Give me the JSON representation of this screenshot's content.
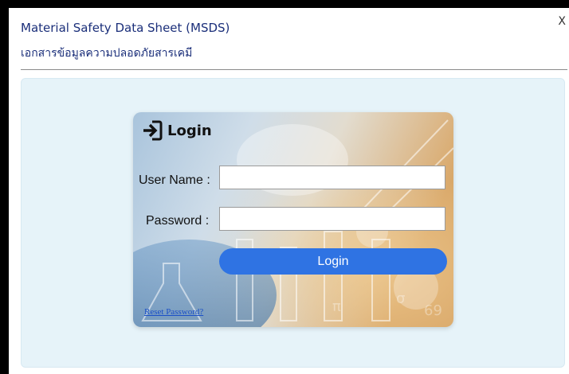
{
  "header": {
    "title": "Material Safety Data Sheet (MSDS)",
    "subtitle": "เอกสารข้อมูลความปลอดภัยสารเคมี",
    "close_label": "X"
  },
  "login": {
    "title": "Login",
    "username_label": "User Name :",
    "username_value": "",
    "password_label": "Password :",
    "password_value": "",
    "submit_label": "Login",
    "reset_link": "Reset Password?"
  },
  "colors": {
    "header_text": "#1b2f7a",
    "panel_bg": "#e6f3f9",
    "button_bg": "#2f73e3",
    "link": "#1a4fc7"
  },
  "icons": {
    "login_icon": "sign-in-icon"
  }
}
